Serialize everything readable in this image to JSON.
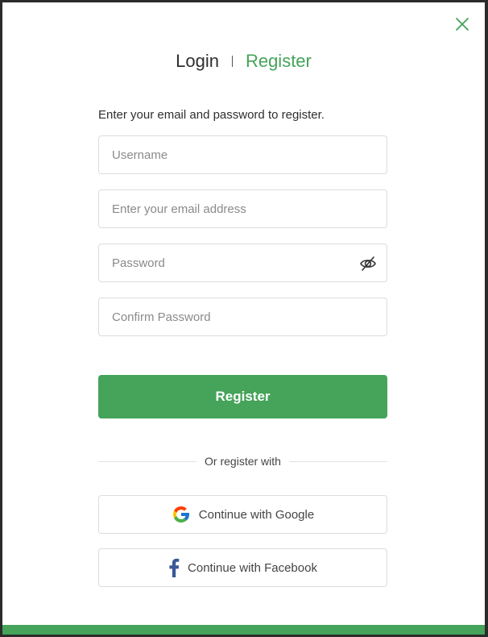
{
  "close": {
    "icon": "close-icon"
  },
  "tabs": {
    "login": "Login",
    "register": "Register"
  },
  "instruction": "Enter your email and password to register.",
  "fields": {
    "username": {
      "placeholder": "Username",
      "value": ""
    },
    "email": {
      "placeholder": "Enter your email address",
      "value": ""
    },
    "password": {
      "placeholder": "Password",
      "value": "",
      "toggle_icon": "eye-off-icon"
    },
    "confirm_password": {
      "placeholder": "Confirm Password",
      "value": ""
    }
  },
  "register_button": "Register",
  "divider_text": "Or register with",
  "social": {
    "google": {
      "label": "Continue with Google",
      "icon": "google-icon"
    },
    "facebook": {
      "label": "Continue with Facebook",
      "icon": "facebook-icon"
    }
  },
  "colors": {
    "accent": "#45a35a",
    "text": "#2f2f2f",
    "border": "#dcdcdc"
  }
}
